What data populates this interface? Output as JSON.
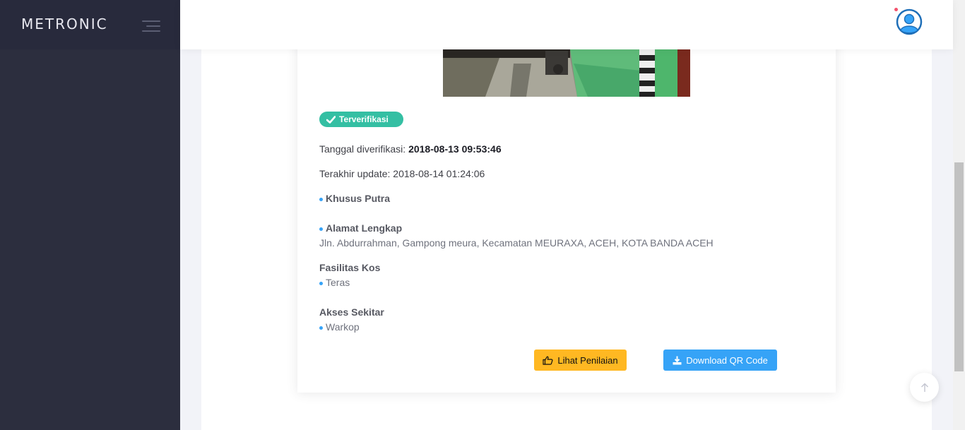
{
  "brand": {
    "name": "METRONIC"
  },
  "badge": {
    "label": "Terverifikasi",
    "color": "#34bfa3"
  },
  "details": {
    "verified_label": "Tanggal diverifikasi: ",
    "verified_value": "2018-08-13 09:53:46",
    "updated_text": "Terakhir update: 2018-08-14 01:24:06"
  },
  "kos_type": "Khusus Putra",
  "address": {
    "heading": "Alamat Lengkap",
    "value": "Jln. Abdurrahman, Gampong meura, Kecamatan MEURAXA, ACEH, KOTA BANDA ACEH"
  },
  "facilities": {
    "heading": "Fasilitas Kos",
    "items": [
      "Teras"
    ]
  },
  "access": {
    "heading": "Akses Sekitar",
    "items": [
      "Warkop"
    ]
  },
  "buttons": {
    "review_label": "Lihat Penilaian",
    "qr_label": "Download QR Code"
  },
  "icons": {
    "menu": "hamburger-icon",
    "user": "user-avatar-icon",
    "check": "check-icon",
    "thumb": "thumbs-up-icon",
    "download": "download-icon",
    "arrow_up": "arrow-up-icon"
  },
  "colors": {
    "sidebar": "#2c2e3e",
    "warning": "#ffb822",
    "info": "#36a3f7",
    "success": "#34bfa3"
  }
}
